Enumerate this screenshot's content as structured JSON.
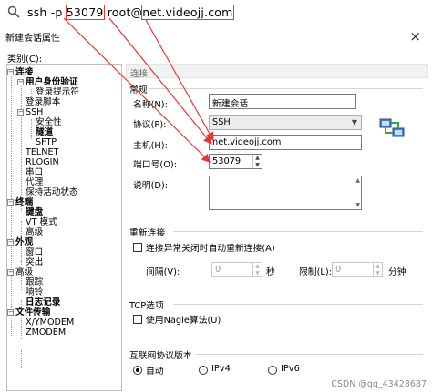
{
  "command": {
    "prefix": "ssh -p ",
    "port": "53079",
    "user": " root@",
    "host": "net.videojj.com"
  },
  "window": {
    "title": "新建会话属性",
    "close": "×",
    "category_label": "类别(C):"
  },
  "tree": [
    {
      "label": "连接",
      "bold": true
    },
    {
      "label": "用户身份验证",
      "bold": true
    },
    {
      "label": "登录提示符",
      "bold": false
    },
    {
      "label": "登录脚本",
      "bold": false
    },
    {
      "label": "SSH",
      "bold": false
    },
    {
      "label": "安全性",
      "bold": false
    },
    {
      "label": "隧道",
      "bold": true
    },
    {
      "label": "SFTP",
      "bold": false
    },
    {
      "label": "TELNET",
      "bold": false
    },
    {
      "label": "RLOGIN",
      "bold": false
    },
    {
      "label": "串口",
      "bold": false
    },
    {
      "label": "代理",
      "bold": false
    },
    {
      "label": "保持活动状态",
      "bold": false
    },
    {
      "label": "终端",
      "bold": true
    },
    {
      "label": "键盘",
      "bold": true
    },
    {
      "label": "VT 模式",
      "bold": false
    },
    {
      "label": "高级",
      "bold": false
    },
    {
      "label": "外观",
      "bold": true
    },
    {
      "label": "窗口",
      "bold": false
    },
    {
      "label": "突出",
      "bold": false
    },
    {
      "label": "高级",
      "bold": false
    },
    {
      "label": "跟踪",
      "bold": false
    },
    {
      "label": "响铃",
      "bold": false
    },
    {
      "label": "日志记录",
      "bold": true
    },
    {
      "label": "文件传输",
      "bold": true
    },
    {
      "label": "X/YMODEM",
      "bold": false
    },
    {
      "label": "ZMODEM",
      "bold": false
    }
  ],
  "panel": {
    "header": "连接",
    "general": {
      "title": "常规",
      "name_label": "名称(N):",
      "name_value": "新建会话",
      "protocol_label": "协议(P):",
      "protocol_value": "SSH",
      "host_label": "主机(H):",
      "host_value": "net.videojj.com",
      "port_label": "端口号(O):",
      "port_value": "53079",
      "desc_label": "说明(D):"
    },
    "reconnect": {
      "title": "重新连接",
      "auto_label": "连接异常关闭时自动重新连接(A)",
      "interval_label": "间隔(V):",
      "interval_value": "0",
      "interval_unit": "秒",
      "limit_label": "限制(L):",
      "limit_value": "0",
      "limit_unit": "分钟"
    },
    "tcp": {
      "title": "TCP选项",
      "nagle_label": "使用Nagle算法(U)"
    },
    "ipver": {
      "title": "互联网协议版本",
      "options": [
        "自动",
        "IPv4",
        "IPv6"
      ],
      "selected": "自动"
    }
  },
  "watermark": "CSDN @qq_43428687",
  "colors": {
    "annotation": "#e53935",
    "tree_line": "#9a9a9a"
  }
}
